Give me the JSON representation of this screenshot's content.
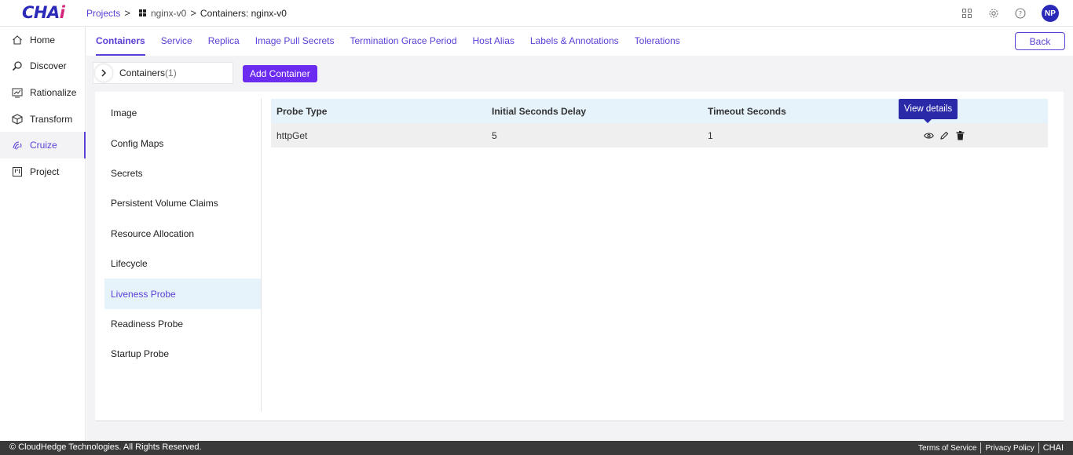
{
  "app": {
    "logo_main": "CHA",
    "logo_accent": "i"
  },
  "breadcrumb": {
    "root": "Projects",
    "project": "nginx-v0",
    "current": "Containers: nginx-v0"
  },
  "header": {
    "avatar_initials": "NP"
  },
  "sidebar": {
    "items": [
      {
        "label": "Home",
        "icon": "home-icon"
      },
      {
        "label": "Discover",
        "icon": "search-icon"
      },
      {
        "label": "Rationalize",
        "icon": "chart-icon"
      },
      {
        "label": "Transform",
        "icon": "cube-icon"
      },
      {
        "label": "Cruize",
        "icon": "fingerprint-icon"
      },
      {
        "label": "Project",
        "icon": "board-icon"
      }
    ]
  },
  "tabs": [
    {
      "label": "Containers"
    },
    {
      "label": "Service"
    },
    {
      "label": "Replica"
    },
    {
      "label": "Image Pull Secrets"
    },
    {
      "label": "Termination Grace Period"
    },
    {
      "label": "Host Alias"
    },
    {
      "label": "Labels & Annotations"
    },
    {
      "label": "Tolerations"
    }
  ],
  "back_label": "Back",
  "containers": {
    "label": "Containers",
    "count": "(1)"
  },
  "add_container_label": "Add Container",
  "subnav": [
    {
      "label": "Image"
    },
    {
      "label": "Config Maps"
    },
    {
      "label": "Secrets"
    },
    {
      "label": "Persistent Volume Claims"
    },
    {
      "label": "Resource Allocation"
    },
    {
      "label": "Lifecycle"
    },
    {
      "label": "Liveness Probe"
    },
    {
      "label": "Readiness Probe"
    },
    {
      "label": "Startup Probe"
    }
  ],
  "table": {
    "headers": [
      "Probe Type",
      "Initial Seconds Delay",
      "Timeout Seconds"
    ],
    "rows": [
      [
        "httpGet",
        "5",
        "1"
      ]
    ]
  },
  "tooltip": "View details",
  "footer": {
    "copyright": "© CloudHedge Technologies. All Rights Reserved.",
    "terms": "Terms of Service",
    "privacy": "Privacy Policy",
    "brand": "CHAI"
  },
  "colors": {
    "accent": "#5b3fd6",
    "logo": "#2b2ab8",
    "button": "#6c2bf0"
  }
}
